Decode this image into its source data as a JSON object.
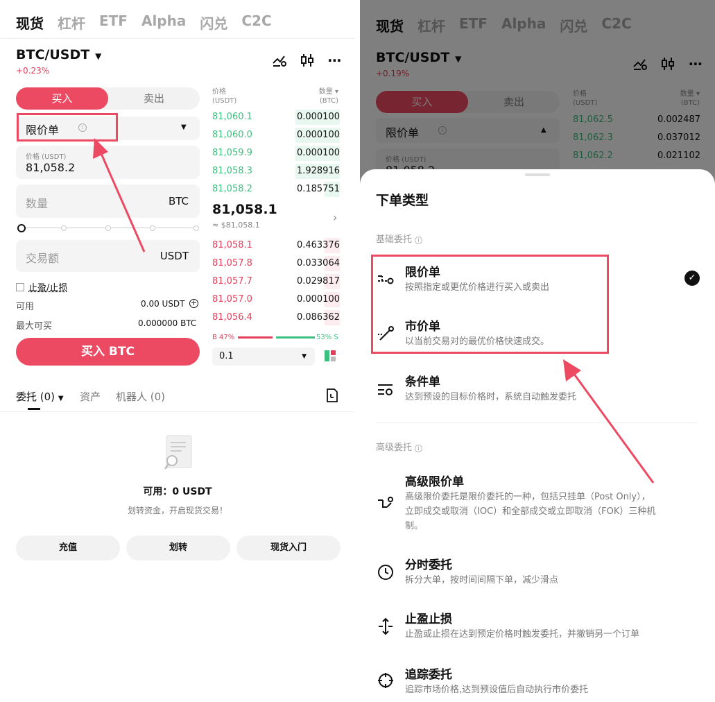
{
  "left": {
    "top_tabs": [
      "现货",
      "杠杆",
      "ETF",
      "Alpha",
      "闪兑",
      "C2C"
    ],
    "pair": "BTC/USDT",
    "change": "+0.23%",
    "buy_label": "买入",
    "sell_label": "卖出",
    "order_type": "限价单",
    "price_label": "价格 (USDT)",
    "price_value": "81,058.2",
    "qty_placeholder": "数量",
    "qty_unit": "BTC",
    "amount_placeholder": "交易额",
    "amount_unit": "USDT",
    "tpsl_label": "止盈/止损",
    "avail_label": "可用",
    "avail_value": "0.00 USDT",
    "max_label": "最大可买",
    "max_value": "0.000000 BTC",
    "buy_button": "买入 BTC",
    "ob_header_price": "价格\n(USDT)",
    "ob_header_qty": "数量 ▾\n(BTC)",
    "asks": [
      {
        "price": "81,060.1",
        "qty": "0.000100",
        "fill": 0.35
      },
      {
        "price": "81,060.0",
        "qty": "0.000100",
        "fill": 0.35
      },
      {
        "price": "81,059.9",
        "qty": "0.000100",
        "fill": 0.35
      },
      {
        "price": "81,058.3",
        "qty": "1.928916",
        "fill": 0.35
      },
      {
        "price": "81,058.2",
        "qty": "0.185751",
        "fill": 0.12
      }
    ],
    "mid_price": "81,058.1",
    "mid_fiat": "≈ $81,058.1",
    "bids": [
      {
        "price": "81,058.1",
        "qty": "0.463376",
        "fill": 0.12
      },
      {
        "price": "81,057.8",
        "qty": "0.033064",
        "fill": 0.12
      },
      {
        "price": "81,057.7",
        "qty": "0.029817",
        "fill": 0.12
      },
      {
        "price": "81,057.0",
        "qty": "0.000100",
        "fill": 0.12
      },
      {
        "price": "81,056.4",
        "qty": "0.086362",
        "fill": 0.12
      }
    ],
    "buy_ratio": "B 47%",
    "sell_ratio": "53% S",
    "depth_step": "0.1",
    "bottom_tabs": [
      "委托 (0)",
      "资产",
      "机器人 (0)"
    ],
    "empty_title": "可用：0 USDT",
    "empty_sub": "划转资金，开启现货交易！",
    "actions": [
      "充值",
      "划转",
      "现货入门"
    ]
  },
  "right": {
    "top_tabs": [
      "现货",
      "杠杆",
      "ETF",
      "Alpha",
      "闪兑",
      "C2C"
    ],
    "pair": "BTC/USDT",
    "change": "+0.19%",
    "buy_label": "买入",
    "sell_label": "卖出",
    "order_type": "限价单",
    "price_label": "价格 (USDT)",
    "price_value": "81,058.2",
    "asks": [
      {
        "price": "81,062.5",
        "qty": "0.002487"
      },
      {
        "price": "81,062.3",
        "qty": "0.037012"
      },
      {
        "price": "81,062.2",
        "qty": "0.021102"
      }
    ],
    "sheet_title": "下单类型",
    "section_basic": "基础委托",
    "section_advanced": "高级委托",
    "options": [
      {
        "icon": "limit-order-icon",
        "title": "限价单",
        "desc": "按照指定或更优价格进行买入或卖出"
      },
      {
        "icon": "market-order-icon",
        "title": "市价单",
        "desc": "以当前交易对的最优价格快速成交。"
      },
      {
        "icon": "conditional-order-icon",
        "title": "条件单",
        "desc": "达到预设的目标价格时，系统自动触发委托"
      },
      {
        "icon": "advanced-limit-icon",
        "title": "高级限价单",
        "desc1": "高级限价委托是限价委托的一种，包括只挂单（Post Only），",
        "desc2": "立即成交或取消（IOC）和全部成交或立即取消（FOK）三种机",
        "desc3": "制。"
      },
      {
        "icon": "clock-icon",
        "title": "分时委托",
        "desc": "拆分大单，按时间间隔下单，减少滑点"
      },
      {
        "icon": "tpsl-icon",
        "title": "止盈止损",
        "desc": "止盈或止损在达到预定价格时触发委托，并撤销另一个订单"
      },
      {
        "icon": "trailing-icon",
        "title": "追踪委托",
        "desc": "追踪市场价格,达到预设值后自动执行市价委托"
      }
    ]
  }
}
